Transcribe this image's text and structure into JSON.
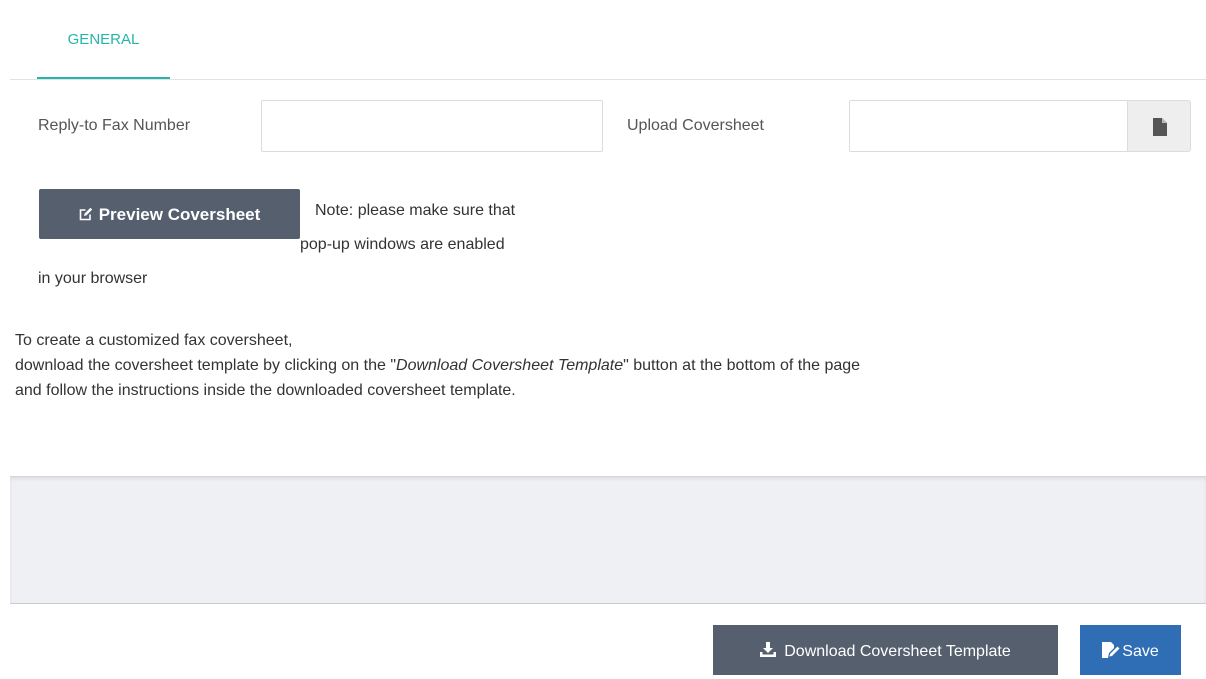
{
  "tabs": [
    {
      "label": "GENERAL",
      "active": true
    }
  ],
  "form": {
    "fax_label": "Reply-to Fax Number",
    "fax_value": "",
    "upload_label": "Upload Coversheet",
    "upload_value": "",
    "upload_icon": "file-icon"
  },
  "preview": {
    "button_label": "Preview Coversheet",
    "button_icon": "edit-icon",
    "note_line1": "Note: please make sure that",
    "note_line2": "pop-up windows are enabled",
    "note_line3": "in your browser"
  },
  "instructions": {
    "line1": "To create a customized fax coversheet,",
    "line2_before": "download the coversheet template by clicking on the \"",
    "line2_emphasis": "Download Coversheet Template",
    "line2_after": "\" button at the bottom of the page",
    "line3": "and follow the instructions inside the downloaded coversheet template."
  },
  "footer": {
    "download_label": "Download Coversheet Template",
    "download_icon": "download-icon",
    "save_label": "Save",
    "save_icon": "save-icon"
  },
  "colors": {
    "accent": "#26b5a9",
    "dark_button": "#555f6e",
    "primary_button": "#2f6eb5",
    "panel_background": "#eef0f4"
  }
}
